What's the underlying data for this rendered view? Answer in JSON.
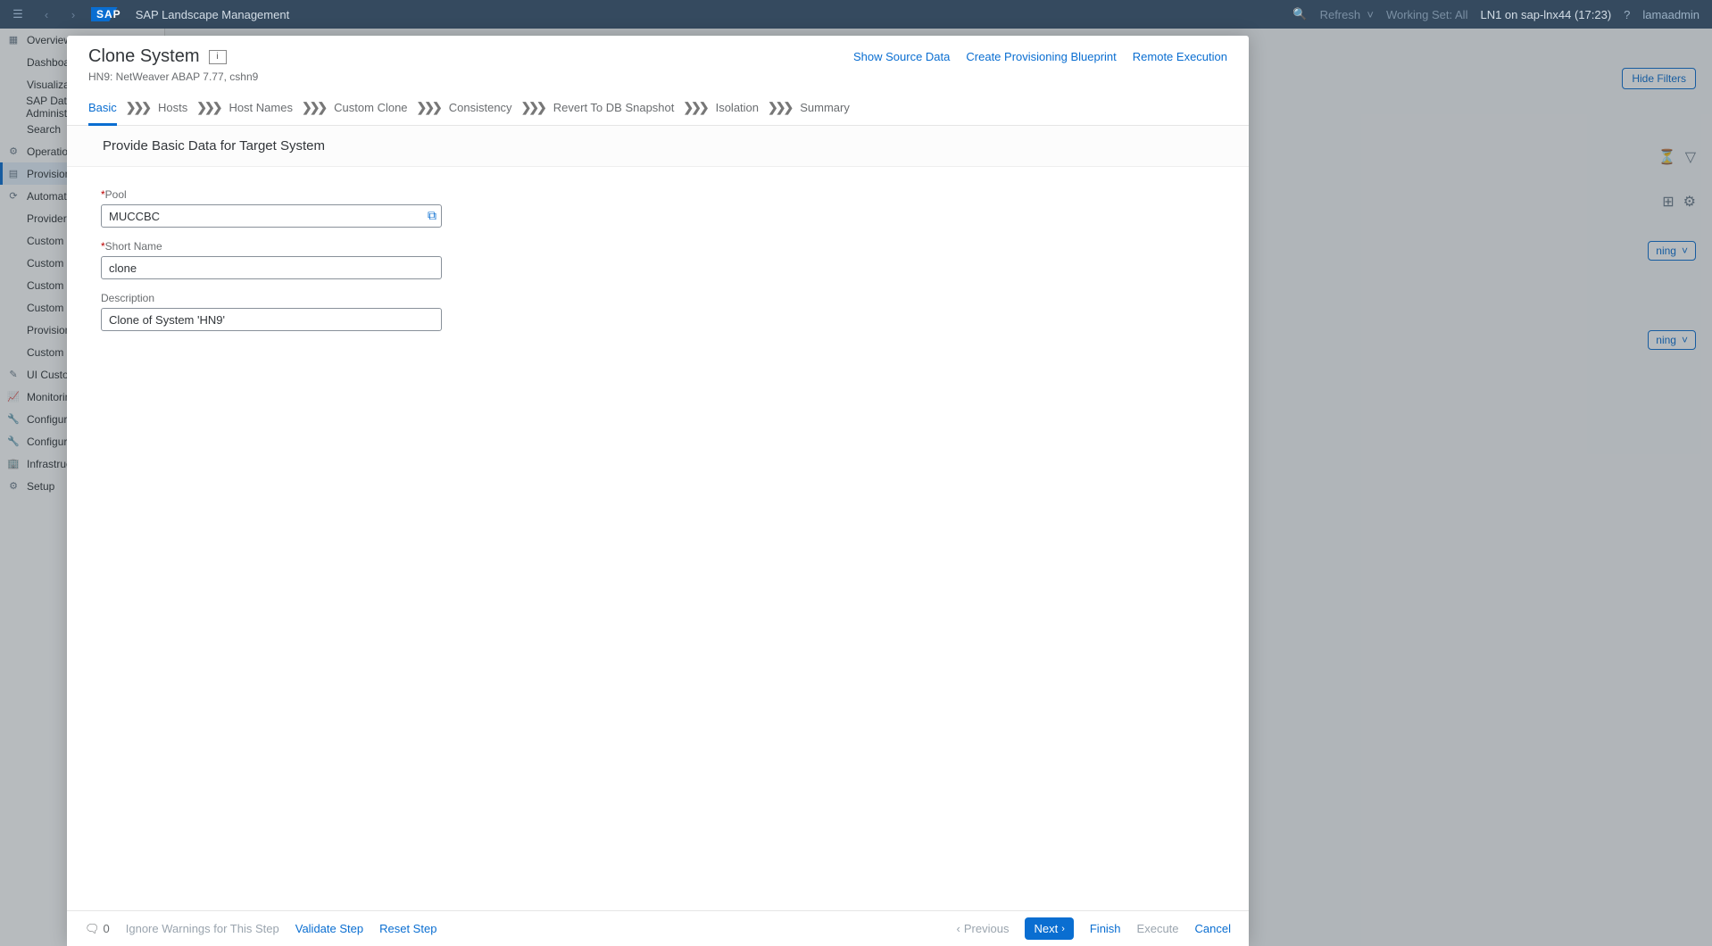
{
  "shell": {
    "title": "SAP Landscape Management",
    "logo": "SAP",
    "refresh": "Refresh",
    "working_set": "Working Set: All",
    "host": "LN1 on sap-lnx44 (17:23)",
    "user": "lamaadmin"
  },
  "sidebar": {
    "items": [
      {
        "label": "Overview"
      },
      {
        "label": "Dashboard"
      },
      {
        "label": "Visualization"
      },
      {
        "label": "SAP Database Administration"
      },
      {
        "label": "Search"
      },
      {
        "label": "Operations"
      },
      {
        "label": "Provisioning"
      },
      {
        "label": "Automation Studio"
      },
      {
        "label": "Provider Implementation"
      },
      {
        "label": "Custom Operations"
      },
      {
        "label": "Custom Hooks"
      },
      {
        "label": "Custom Processes"
      },
      {
        "label": "Custom Notifications"
      },
      {
        "label": "Provisioning Blueprints"
      },
      {
        "label": "Custom Provisioning"
      },
      {
        "label": "UI Customizations"
      },
      {
        "label": "Monitoring"
      },
      {
        "label": "Configuration"
      },
      {
        "label": "Configuration Extensions"
      },
      {
        "label": "Infrastructure"
      },
      {
        "label": "Setup"
      }
    ],
    "selected_index": 6
  },
  "bg": {
    "hide_filters": "Hide Filters",
    "dd_suffix": "ning"
  },
  "dialog": {
    "title": "Clone System",
    "subtitle": "HN9: NetWeaver ABAP 7.77, cshn9",
    "links": {
      "show_source": "Show Source Data",
      "create_blueprint": "Create Provisioning Blueprint",
      "remote_exec": "Remote Execution"
    },
    "steps": [
      "Basic",
      "Hosts",
      "Host Names",
      "Custom Clone",
      "Consistency",
      "Revert To DB Snapshot",
      "Isolation",
      "Summary"
    ],
    "active_step": 0,
    "section_title": "Provide Basic Data for Target System",
    "form": {
      "pool": {
        "label": "Pool",
        "required": true,
        "value": "MUCCBC"
      },
      "short_name": {
        "label": "Short Name",
        "required": true,
        "value": "clone"
      },
      "description": {
        "label": "Description",
        "required": false,
        "value": "Clone of System 'HN9'"
      }
    },
    "footer": {
      "msg_count": "0",
      "ignore": "Ignore Warnings for This Step",
      "validate": "Validate Step",
      "reset": "Reset Step",
      "previous": "Previous",
      "next": "Next",
      "finish": "Finish",
      "execute": "Execute",
      "cancel": "Cancel"
    }
  }
}
